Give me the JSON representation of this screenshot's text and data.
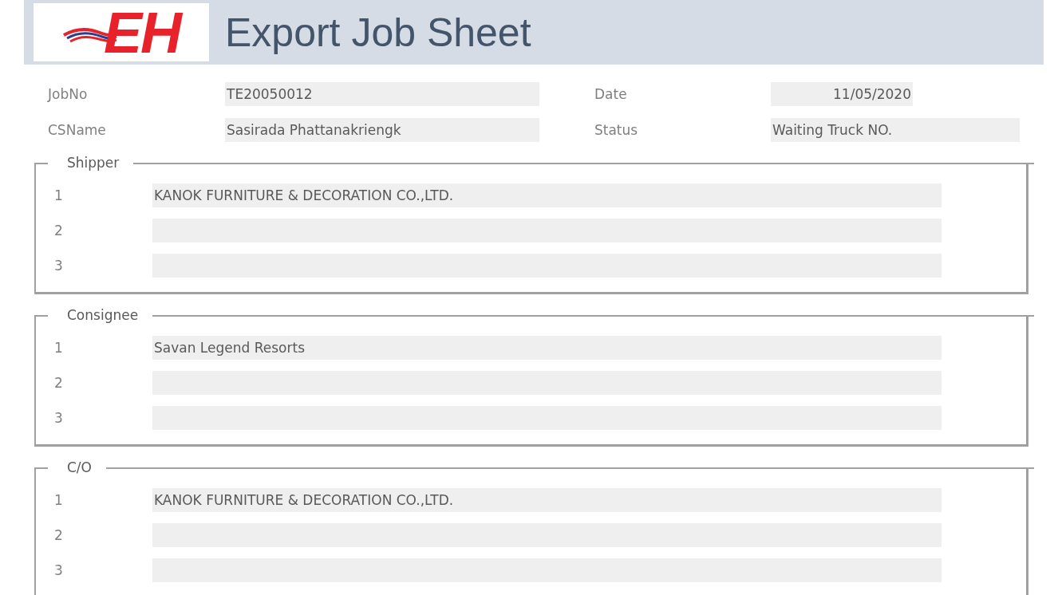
{
  "header": {
    "logo_text": "EH",
    "title": "Export Job Sheet"
  },
  "fields": [
    {
      "label": "JobNo",
      "value": "TE20050012"
    },
    {
      "label": "Date",
      "value": "11/05/2020"
    },
    {
      "label": "CSName",
      "value": "Sasirada Phattanakriengk"
    },
    {
      "label": "Status",
      "value": "Waiting Truck NO."
    }
  ],
  "groups": [
    {
      "title": "Shipper",
      "lines": [
        {
          "number": "1",
          "value": "KANOK FURNITURE & DECORATION CO.,LTD."
        },
        {
          "number": "2"
        },
        {
          "number": "3"
        }
      ]
    },
    {
      "title": "Consignee",
      "lines": [
        {
          "number": "1",
          "value": "Savan Legend Resorts"
        },
        {
          "number": "2"
        },
        {
          "number": "3"
        }
      ]
    },
    {
      "title": "C/O",
      "lines": [
        {
          "number": "1",
          "value": "KANOK FURNITURE & DECORATION CO.,LTD."
        },
        {
          "number": "2"
        },
        {
          "number": "3"
        }
      ]
    }
  ]
}
